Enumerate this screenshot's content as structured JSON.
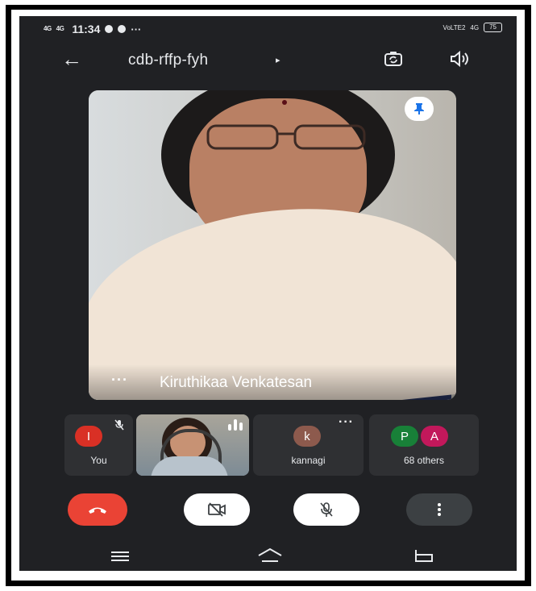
{
  "status_bar": {
    "network_1": "4G",
    "network_2": "4G",
    "time": "11:34",
    "extra": "···",
    "volte": "VoLTE2",
    "net_right": "4G",
    "battery": "75"
  },
  "header": {
    "meeting_code": "cdb-rffp-fyh",
    "arrow": "▸"
  },
  "main_video": {
    "speaker_name": "Kiruthikaa Venkatesan",
    "more": "···"
  },
  "participants": [
    {
      "initial": "I",
      "label": "You",
      "color": "#d93025"
    },
    {
      "initial": "k",
      "label": "kannagi",
      "color": "#8d5a4d"
    },
    {
      "initials": [
        "P",
        "A"
      ],
      "label": "68 others",
      "colors": [
        "#188038",
        "#c2185b"
      ]
    }
  ],
  "tile_more": "···",
  "colors": {
    "background": "#202124",
    "end_call": "#ea4335",
    "tile": "#2f3033"
  }
}
